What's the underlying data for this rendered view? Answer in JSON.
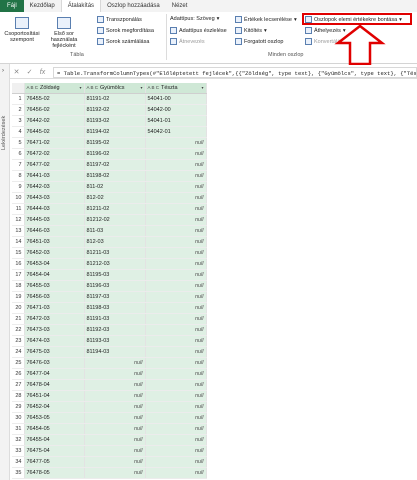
{
  "tabs": [
    "Fájl",
    "Kezdőlap",
    "Átalakítás",
    "Oszlop hozzáadása",
    "Nézet"
  ],
  "ribbon": {
    "group_by": "Csoportosítási szempont",
    "use_first_row": "Első sor használata fejlécként",
    "transpose": "Transzponálás",
    "reverse_rows": "Sorok megfordítása",
    "count_rows": "Sorok számlálása",
    "data_type": "Adattípus: Szöveg",
    "detect_type": "Adattípus észlelése",
    "rename": "Átnevezés",
    "replace_values": "Értékek lecserélése",
    "fill": "Kitöltés",
    "pivot": "Forgatott oszlop",
    "unpivot": "Oszlopok elemi értékekre bontása",
    "move": "Áthelyezés",
    "convert_list": "Konvertálás listává",
    "group_table": "Tábla",
    "group_anycol": "Minden oszlop"
  },
  "formula": {
    "cancel": "✕",
    "confirm": "✓",
    "fx": "fx",
    "text": "= Table.TransformColumnTypes(#\"Előléptetett fejlécek\",{{\"Zöldség\", type text}, {\"Gyümölcs\", type text}, {\"Tészta\", type text}})"
  },
  "left_pane": {
    "toggle": "›",
    "label": "Lekérdezések"
  },
  "table": {
    "columns": [
      "Zöldség",
      "Gyümölcs",
      "Tészta"
    ],
    "type_icon": "A B C",
    "null_label": "null",
    "rows": [
      [
        "1",
        "76455-02",
        "81191-02",
        "54041-00"
      ],
      [
        "2",
        "76456-02",
        "81192-02",
        "54042-00"
      ],
      [
        "3",
        "76442-02",
        "81193-02",
        "54041-01"
      ],
      [
        "4",
        "76445-02",
        "81194-02",
        "54042-01"
      ],
      [
        "5",
        "76471-02",
        "81195-02",
        "null"
      ],
      [
        "6",
        "76472-02",
        "81196-02",
        "null"
      ],
      [
        "7",
        "76477-02",
        "81197-02",
        "null"
      ],
      [
        "8",
        "76441-03",
        "81198-02",
        "null"
      ],
      [
        "9",
        "76442-03",
        "811-02",
        "null"
      ],
      [
        "10",
        "76443-03",
        "812-02",
        "null"
      ],
      [
        "11",
        "76444-03",
        "81211-02",
        "null"
      ],
      [
        "12",
        "76445-03",
        "81212-02",
        "null"
      ],
      [
        "13",
        "76446-03",
        "811-03",
        "null"
      ],
      [
        "14",
        "76451-03",
        "812-03",
        "null"
      ],
      [
        "15",
        "76452-03",
        "81211-03",
        "null"
      ],
      [
        "16",
        "76453-04",
        "81212-03",
        "null"
      ],
      [
        "17",
        "76454-04",
        "81195-03",
        "null"
      ],
      [
        "18",
        "76455-03",
        "81196-03",
        "null"
      ],
      [
        "19",
        "76456-03",
        "81197-03",
        "null"
      ],
      [
        "20",
        "76471-03",
        "81198-03",
        "null"
      ],
      [
        "21",
        "76472-03",
        "81191-03",
        "null"
      ],
      [
        "22",
        "76473-03",
        "81192-03",
        "null"
      ],
      [
        "23",
        "76474-03",
        "81193-03",
        "null"
      ],
      [
        "24",
        "76475-03",
        "81194-03",
        "null"
      ],
      [
        "25",
        "76476-03",
        "null",
        "null"
      ],
      [
        "26",
        "76477-04",
        "null",
        "null"
      ],
      [
        "27",
        "76478-04",
        "null",
        "null"
      ],
      [
        "28",
        "76451-04",
        "null",
        "null"
      ],
      [
        "29",
        "76452-04",
        "null",
        "null"
      ],
      [
        "30",
        "76453-05",
        "null",
        "null"
      ],
      [
        "31",
        "76454-05",
        "null",
        "null"
      ],
      [
        "32",
        "76455-04",
        "null",
        "null"
      ],
      [
        "33",
        "76475-04",
        "null",
        "null"
      ],
      [
        "34",
        "76477-05",
        "null",
        "null"
      ],
      [
        "35",
        "76478-05",
        "null",
        "null"
      ]
    ]
  },
  "colors": {
    "file_tab": "#217346",
    "selected_column": "#dff0e4",
    "highlight": "#e00000"
  }
}
